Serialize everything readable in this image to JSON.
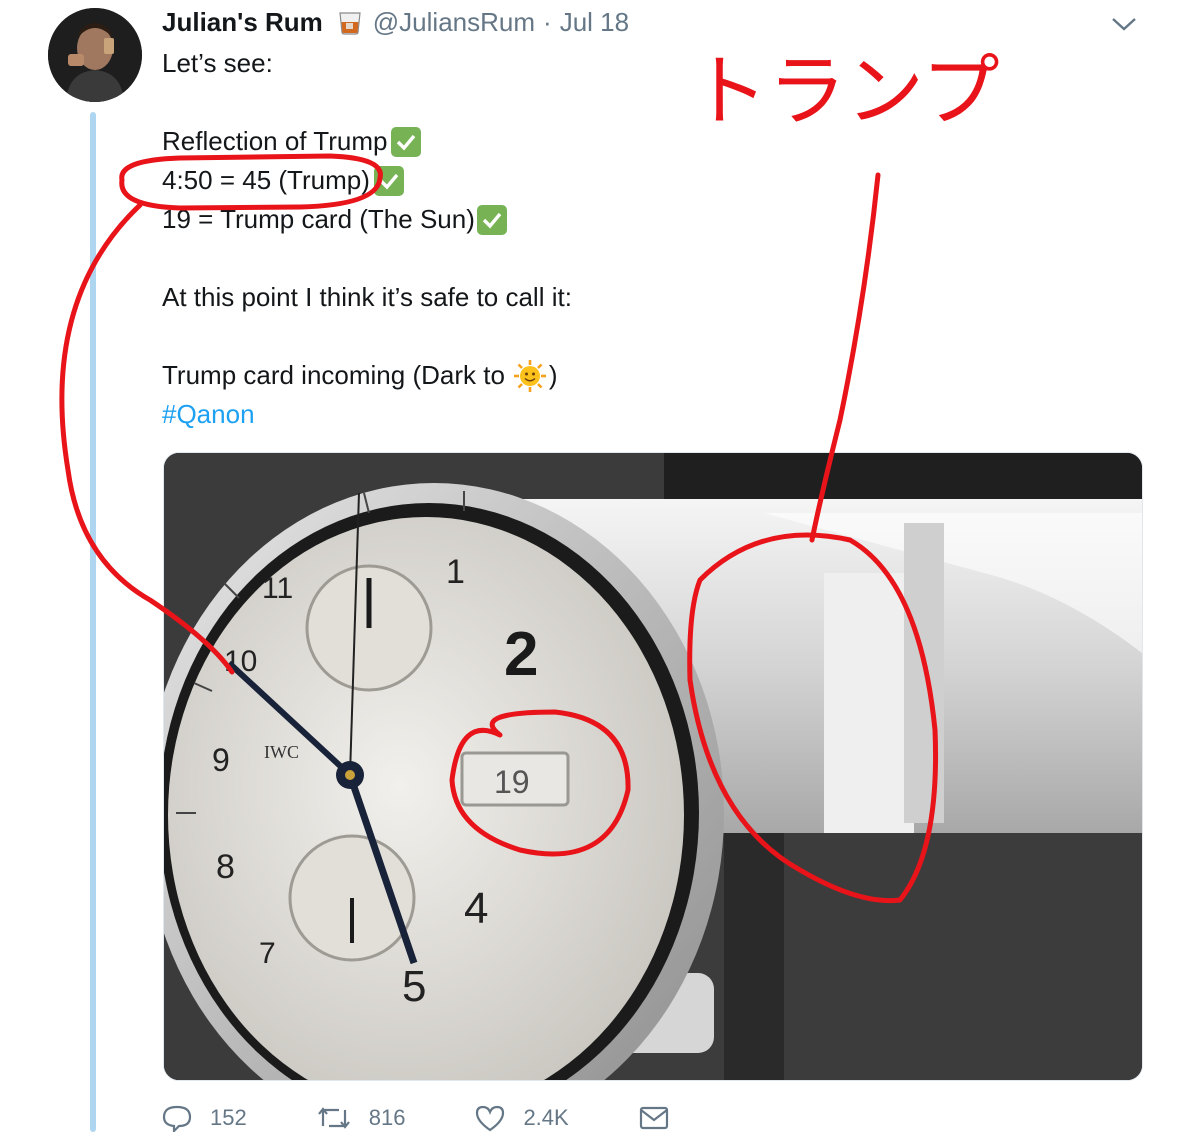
{
  "tweet": {
    "display_name": "Julian's Rum",
    "handle": "@JuliansRum",
    "separator": "·",
    "date": "Jul 18",
    "lines": {
      "greeting": "Let’s see:",
      "reflection": "Reflection of Trump",
      "time_eq": "4:50 = 45 (Trump)",
      "card_eq": "19 = Trump card (The Sun)",
      "safe": "At this point I think it’s safe to call it:",
      "incoming_pre": "Trump card incoming (Dark to",
      "incoming_post": ")",
      "hashtag": "#Qanon"
    }
  },
  "media": {
    "dial_numbers": [
      "11",
      "1",
      "2",
      "10",
      "9",
      "8",
      "7",
      "5",
      "4"
    ],
    "brand": "IWC",
    "date_window": "19"
  },
  "annotation": {
    "katakana": "トランプ"
  },
  "actions": {
    "replies": "152",
    "retweets": "816",
    "likes": "2.4K"
  },
  "colors": {
    "link": "#1da1f2",
    "thread_line": "#aed6f1",
    "annotation_red": "#e8141a",
    "check_green": "#77b255"
  }
}
